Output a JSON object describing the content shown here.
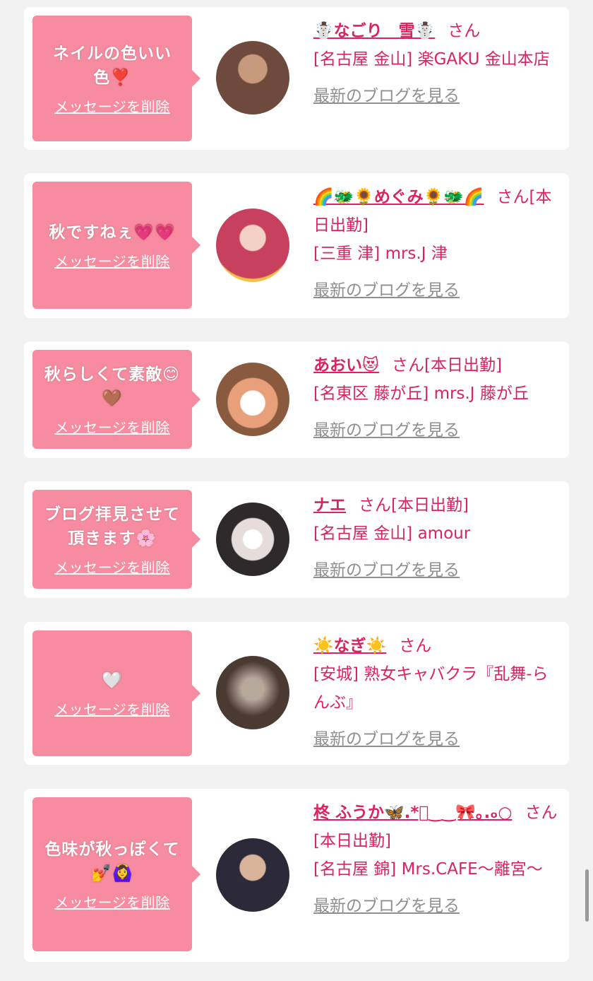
{
  "delete_label": "メッセージを削除",
  "blog_label": "最新のブログを見る",
  "san_label": "さん",
  "colors": {
    "accent": "#d9245e",
    "bubble": "#f78ba0",
    "link_gray": "#8f8f8f",
    "background": "#f2f2f2"
  },
  "messages": [
    {
      "message": "ネイルの色いい色❣️",
      "name": "☃️なごり　雪☃️",
      "suffix": "",
      "shop": "[名古屋 金山] 楽GAKU 金山本店",
      "avatar_icon": "profile-photo",
      "avatar_colors": [
        "#6e4a3c",
        "#c79a7e"
      ]
    },
    {
      "message": "秋ですねぇ💗💗",
      "name": "🌈🐲🌻めぐみ🌻🐲🌈",
      "suffix": "[本日出勤]",
      "shop": "[三重 津] mrs.J 津",
      "avatar_icon": "profile-photo",
      "avatar_colors": [
        "#c7415f",
        "#f2c04a"
      ]
    },
    {
      "message": "秋らしくて素敵😊🤎",
      "name": "あおい😻",
      "suffix": "[本日出勤]",
      "shop": "[名東区 藤が丘] mrs.J 藤が丘",
      "avatar_icon": "profile-photo",
      "avatar_colors": [
        "#8a5a3e",
        "#e8a07a"
      ]
    },
    {
      "message": "ブログ拝見させて頂きます🌸",
      "name": "ナエ",
      "suffix": "[本日出勤]",
      "shop": "[名古屋 金山] amour",
      "avatar_icon": "profile-photo",
      "avatar_colors": [
        "#2e2a2c",
        "#e6dcdc"
      ]
    },
    {
      "message": "🤍",
      "name": "☀️なぎ☀️",
      "suffix": "",
      "shop": "[安城] 熟女キャバクラ『乱舞-らんぶ』",
      "avatar_icon": "profile-photo",
      "avatar_colors": [
        "#4a3a32",
        "#b7a89c"
      ]
    },
    {
      "message": "色味が秋っぽくて💅🙆‍♀️",
      "name": "柊 ふうか🦋.*ﾟ‿‿🎀｡.ₒ○",
      "suffix": "[本日出勤]",
      "shop": "[名古屋 錦] Mrs.CAFE～離宮～",
      "avatar_icon": "profile-photo",
      "avatar_colors": [
        "#2c2a38",
        "#d9b39a"
      ]
    }
  ]
}
